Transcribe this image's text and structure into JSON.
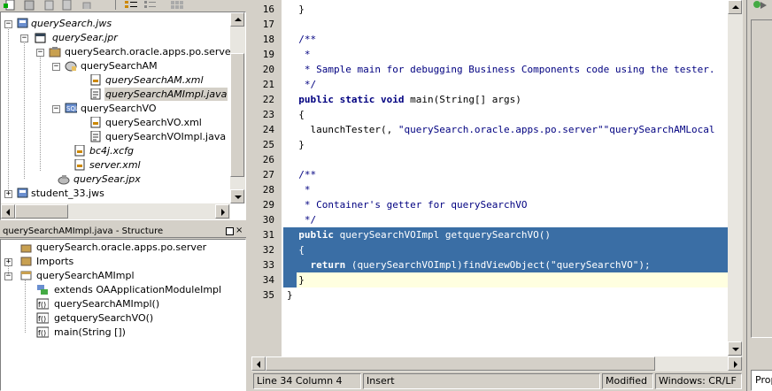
{
  "toolbar": {
    "icons": [
      "new-file-icon",
      "new-workspace-icon",
      "open-icon",
      "save-icon",
      "list-icon",
      "list-view-icon",
      "grid-icon"
    ]
  },
  "navigator": {
    "items": [
      {
        "label": "querySearch.jws",
        "italic": true
      },
      {
        "label": "querySear.jpr",
        "italic": true
      },
      {
        "label": "querySearch.oracle.apps.po.server",
        "italic": false
      },
      {
        "label": "querySearchAM",
        "italic": false
      },
      {
        "label": "querySearchAM.xml",
        "italic": true
      },
      {
        "label": "querySearchAMImpl.java",
        "italic": true
      },
      {
        "label": "querySearchVO",
        "italic": false
      },
      {
        "label": "querySearchVO.xml",
        "italic": false
      },
      {
        "label": "querySearchVOImpl.java",
        "italic": false
      },
      {
        "label": "bc4j.xcfg",
        "italic": true
      },
      {
        "label": "server.xml",
        "italic": true
      },
      {
        "label": "querySear.jpx",
        "italic": true
      },
      {
        "label": "student_33.jws",
        "italic": false
      }
    ]
  },
  "structure": {
    "title": "querySearchAMImpl.java - Structure",
    "items": [
      {
        "label": "querySearch.oracle.apps.po.server"
      },
      {
        "label": "Imports"
      },
      {
        "label": "querySearchAMImpl"
      },
      {
        "label": "extends OAApplicationModuleImpl"
      },
      {
        "label": "querySearchAMImpl()"
      },
      {
        "label": "getquerySearchVO()"
      },
      {
        "label": "main(String [])"
      }
    ]
  },
  "editor": {
    "lines": [
      {
        "n": "16",
        "text": "  }"
      },
      {
        "n": "17",
        "text": ""
      },
      {
        "n": "18",
        "text": "  /**"
      },
      {
        "n": "19",
        "text": "   *"
      },
      {
        "n": "20",
        "text": "   * Sample main for debugging Business Components code using the tester."
      },
      {
        "n": "21",
        "text": "   */"
      },
      {
        "n": "22",
        "a": "  ",
        "k": "public static void",
        "b": " main(String[] args)"
      },
      {
        "n": "23",
        "text": "  {"
      },
      {
        "n": "24",
        "a": "    launchTester(",
        "s": "\"querySearch.oracle.apps.po.server\"",
        "b": ", ",
        "s2": "\"querySearchAMLocal"
      },
      {
        "n": "25",
        "text": "  }"
      },
      {
        "n": "26",
        "text": ""
      },
      {
        "n": "27",
        "text": "  /**"
      },
      {
        "n": "28",
        "text": "   *"
      },
      {
        "n": "29",
        "text": "   * Container's getter for querySearchVO"
      },
      {
        "n": "30",
        "text": "   */"
      },
      {
        "n": "31",
        "a": "  ",
        "k": "public",
        "b": " querySearchVOImpl getquerySearchVO()"
      },
      {
        "n": "32",
        "text": "  {"
      },
      {
        "n": "33",
        "a": "    ",
        "k": "return",
        "b": " (querySearchVOImpl)findViewObject(",
        "s": "\"querySearchVO\"",
        "b2": ");"
      },
      {
        "n": "34",
        "text": "  }"
      },
      {
        "n": "35",
        "text": "}"
      }
    ]
  },
  "status": {
    "position": "Line 34 Column 4",
    "mode": "Insert",
    "modified": "Modified",
    "line_ending": "Windows: CR/LF"
  },
  "right_panel": {
    "label": "Prop"
  },
  "colors": {
    "selection": "#3a6ea5",
    "current_line": "#ffffe0",
    "keyword": "#000080"
  }
}
